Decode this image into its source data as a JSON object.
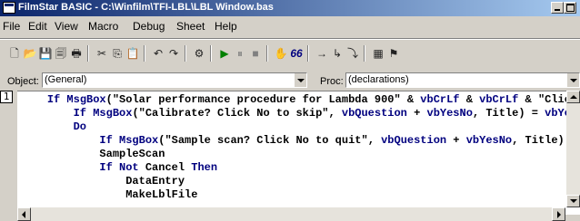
{
  "window": {
    "title": "FilmStar BASIC - C:\\Winfilm\\TFI-LBL\\LBL Window.bas"
  },
  "menu": [
    "File",
    "Edit",
    "View",
    "Macro",
    "Debug",
    "Sheet",
    "Help"
  ],
  "toolbar": {
    "icons": [
      "new-file-icon",
      "open-folder-icon",
      "save-icon",
      "save-all-icon",
      "print-icon",
      "cut-icon",
      "copy-icon",
      "paste-icon",
      "undo-icon",
      "redo-icon",
      "dialog-editor-icon",
      "run-icon",
      "pause-icon",
      "stop-icon",
      "toggle-breakpoint-icon",
      "quick-watch-icon",
      "step-into-icon",
      "step-over-icon",
      "step-out-icon",
      "object-browser-icon",
      "references-icon"
    ],
    "glyphs": [
      "🗋",
      "📂",
      "💾",
      "🗐",
      "🖶",
      "✂",
      "⎘",
      "📋",
      "↶",
      "↷",
      "⚙",
      "▶",
      "⏸",
      "■",
      "✋",
      "66",
      "→",
      "↳",
      "⤵",
      "▦",
      "⚑"
    ]
  },
  "object_selector": {
    "label": "Object:",
    "value": "(General)"
  },
  "proc_selector": {
    "label": "Proc:",
    "value": "(declarations)"
  },
  "editor": {
    "line_number": "1",
    "lines": [
      {
        "indent": "    ",
        "parts": [
          [
            "kw",
            "If "
          ],
          [
            "kw",
            "MsgBox"
          ],
          [
            "t",
            "(\"Solar performance procedure for Lambda 900\" & "
          ],
          [
            "kw",
            "vbCrLf"
          ],
          [
            "t",
            " & "
          ],
          [
            "kw",
            "vbCrLf"
          ],
          [
            "t",
            " & \"Click"
          ]
        ]
      },
      {
        "indent": "        ",
        "parts": [
          [
            "kw",
            "If "
          ],
          [
            "kw",
            "MsgBox"
          ],
          [
            "t",
            "(\"Calibrate? Click No to skip\", "
          ],
          [
            "kw",
            "vbQuestion"
          ],
          [
            "t",
            " + "
          ],
          [
            "kw",
            "vbYesNo"
          ],
          [
            "t",
            ", Title) = "
          ],
          [
            "kw",
            "vbYes"
          ]
        ]
      },
      {
        "indent": "        ",
        "parts": [
          [
            "kw",
            "Do"
          ]
        ]
      },
      {
        "indent": "            ",
        "parts": [
          [
            "kw",
            "If "
          ],
          [
            "kw",
            "MsgBox"
          ],
          [
            "t",
            "(\"Sample scan? Click No to quit\", "
          ],
          [
            "kw",
            "vbQuestion"
          ],
          [
            "t",
            " + "
          ],
          [
            "kw",
            "vbYesNo"
          ],
          [
            "t",
            ", Title) ="
          ]
        ]
      },
      {
        "indent": "            ",
        "parts": [
          [
            "t",
            "SampleScan"
          ]
        ]
      },
      {
        "indent": "            ",
        "parts": [
          [
            "kw",
            "If Not "
          ],
          [
            "t",
            "Cancel "
          ],
          [
            "kw",
            "Then"
          ]
        ]
      },
      {
        "indent": "                ",
        "parts": [
          [
            "t",
            "DataEntry"
          ]
        ]
      },
      {
        "indent": "                ",
        "parts": [
          [
            "t",
            "MakeLblFile"
          ]
        ]
      }
    ]
  }
}
